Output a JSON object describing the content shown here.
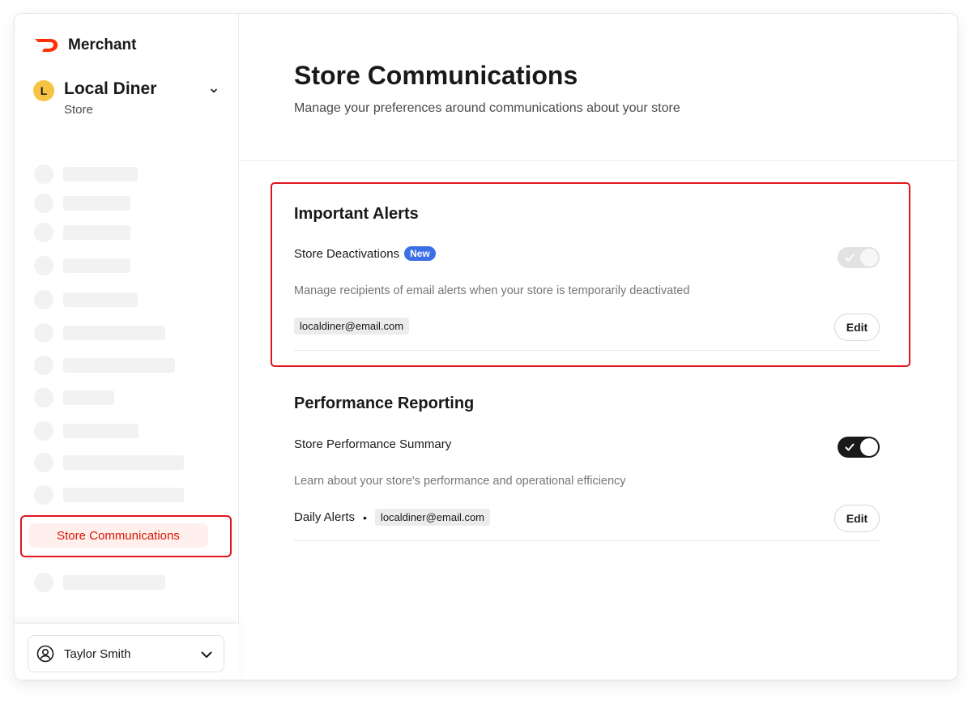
{
  "brand": {
    "name": "Merchant",
    "accent": "#ff3008"
  },
  "store": {
    "initial": "L",
    "name": "Local Diner",
    "type": "Store"
  },
  "sidebar": {
    "active_item": "Store Communications"
  },
  "user": {
    "name": "Taylor Smith"
  },
  "page": {
    "title": "Store Communications",
    "subtitle": "Manage your preferences around communications about your store"
  },
  "sections": {
    "important_alerts": {
      "title": "Important Alerts",
      "row_title": "Store Deactivations",
      "badge": "New",
      "description": "Manage recipients of email alerts when your store is temporarily deactivated",
      "email": "localdiner@email.com",
      "edit_label": "Edit",
      "toggle_state": "on (disabled)"
    },
    "performance_reporting": {
      "title": "Performance Reporting",
      "row_title": "Store Performance Summary",
      "description": "Learn about your store's performance and operational efficiency",
      "frequency": "Daily Alerts",
      "separator": "•",
      "email": "localdiner@email.com",
      "edit_label": "Edit",
      "toggle_state": "on"
    }
  },
  "colors": {
    "highlight": "#e1141f",
    "badge": "#3c6ee6",
    "active_nav_bg": "#fff0ee",
    "active_nav_text": "#d91400"
  }
}
